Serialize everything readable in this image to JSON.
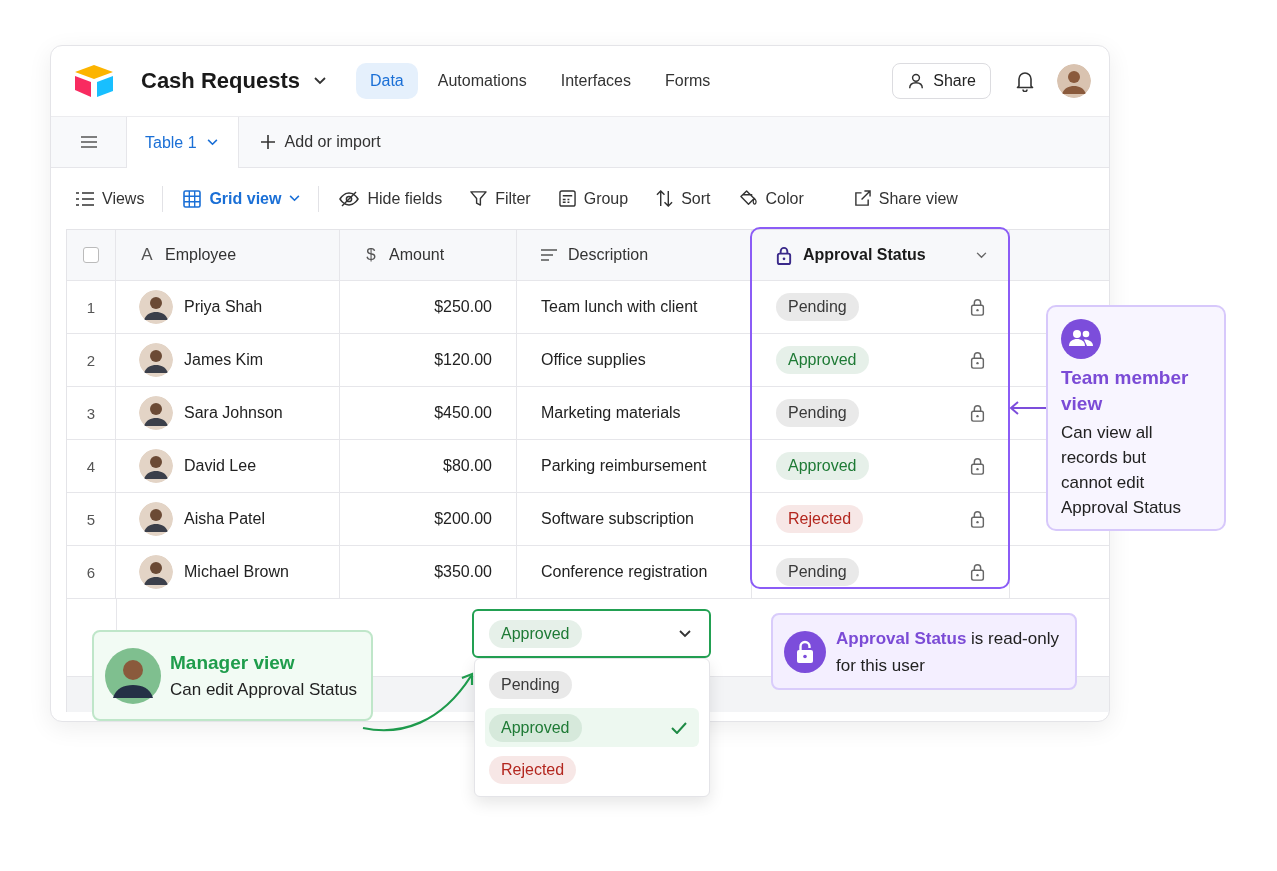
{
  "app": {
    "title": "Cash Requests",
    "nav": [
      {
        "label": "Data",
        "selected": true
      },
      {
        "label": "Automations",
        "selected": false
      },
      {
        "label": "Interfaces",
        "selected": false
      },
      {
        "label": "Forms",
        "selected": false
      }
    ],
    "share": "Share"
  },
  "tables": {
    "tabs": [
      {
        "label": "Table 1",
        "selected": true
      }
    ],
    "add": "Add or import"
  },
  "toolbar": {
    "views": "Views",
    "view": "Grid view",
    "actions": [
      {
        "kind": "hide",
        "label": "Hide fields"
      },
      {
        "kind": "filter",
        "label": "Filter"
      },
      {
        "kind": "group",
        "label": "Group"
      },
      {
        "kind": "sort",
        "label": "Sort"
      },
      {
        "kind": "color",
        "label": "Color"
      },
      {
        "kind": "share",
        "label": "Share view"
      }
    ]
  },
  "grid": {
    "select_all": {
      "checked": false
    },
    "columns": [
      {
        "kind": "text",
        "glyph": "A",
        "label": "Employee",
        "highlighted": false
      },
      {
        "kind": "currency",
        "glyph": "$",
        "label": "Amount",
        "highlighted": false
      },
      {
        "kind": "longtext",
        "label": "Description",
        "highlighted": false
      },
      {
        "kind": "status",
        "label": "Approval Status",
        "highlighted": true
      }
    ],
    "rows": [
      {
        "num": "1",
        "employee": "Priya Shah",
        "amount": "$250.00",
        "description": "Team lunch with client",
        "status": "Pending",
        "color": "#3a3a3a",
        "locked": true
      },
      {
        "num": "2",
        "employee": "James Kim",
        "amount": "$120.00",
        "description": "Office supplies",
        "status": "Approved",
        "color": "#1e7a35",
        "locked": true
      },
      {
        "num": "3",
        "employee": "Sara Johnson",
        "amount": "$450.00",
        "description": "Marketing materials",
        "status": "Pending",
        "color": "#3a3a3a",
        "locked": true
      },
      {
        "num": "4",
        "employee": "David Lee",
        "amount": "$80.00",
        "description": "Parking reimbursement",
        "status": "Approved",
        "color": "#1e7a35",
        "locked": true
      },
      {
        "num": "5",
        "employee": "Aisha Patel",
        "amount": "$200.00",
        "description": "Software subscription",
        "status": "Rejected",
        "color": "#b3261e",
        "locked": true
      },
      {
        "num": "6",
        "employee": "Michael Brown",
        "amount": "$350.00",
        "description": "Conference registration",
        "status": "Pending",
        "color": "#3a3a3a",
        "locked": true
      }
    ]
  },
  "editor": {
    "value": "Approved",
    "color": "#1e7a35",
    "options": [
      {
        "label": "Pending",
        "color": "#3a3a3a",
        "selected": false
      },
      {
        "label": "Approved",
        "color": "#1e7a35",
        "selected": true
      },
      {
        "label": "Rejected",
        "color": "#b3261e",
        "selected": false
      }
    ]
  },
  "callouts": {
    "manager": {
      "title": "Manager view",
      "text": "Can edit Approval Status"
    },
    "team": {
      "title": "Team member view",
      "text": "Can view all records but cannot edit Approval Status"
    },
    "readonly": {
      "text": "**Approval Status** is read-only for this user"
    }
  }
}
